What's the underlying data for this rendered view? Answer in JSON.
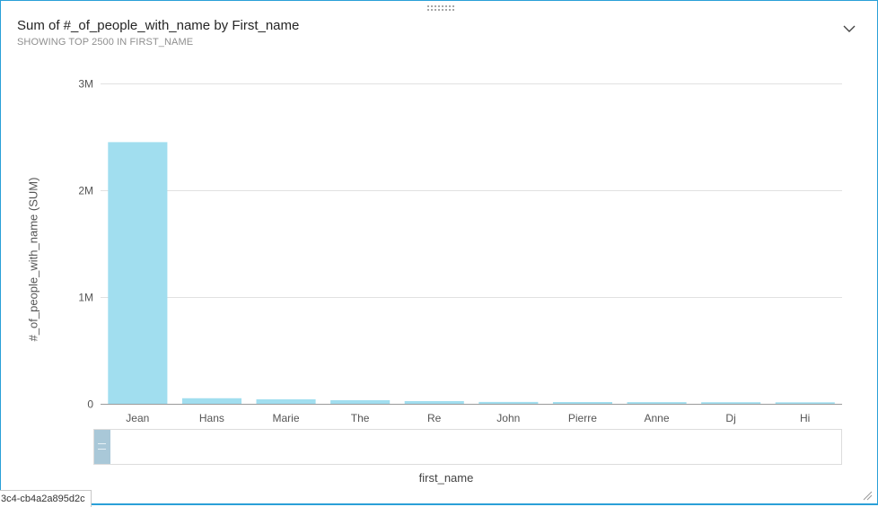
{
  "panel": {
    "title": "Sum of #_of_people_with_name by First_name",
    "subtitle": "SHOWING TOP 2500 IN FIRST_NAME",
    "tooltip_text": "3c4-cb4a2a895d2c"
  },
  "icons": {
    "drag": "drag-handle-icon",
    "chevron": "chevron-down-icon",
    "resize": "resize-grip-icon"
  },
  "colors": {
    "bar": "#a1deef",
    "gridline": "#e1e1e1",
    "axis": "#9a9a9a",
    "border": "#2aa0d8",
    "scroll_thumb": "#a9c8d8"
  },
  "chart_data": {
    "type": "bar",
    "categories": [
      "Jean",
      "Hans",
      "Marie",
      "The",
      "Re",
      "John",
      "Pierre",
      "Anne",
      "Dj",
      "Hi"
    ],
    "values": [
      2450000,
      52000,
      42000,
      34000,
      25000,
      18000,
      17000,
      16000,
      15000,
      14000
    ],
    "xlabel": "first_name",
    "ylabel": "#_of_people_with_name (SUM)",
    "ylim": [
      0,
      3000000
    ],
    "yticks": [
      {
        "value": 0,
        "label": "0"
      },
      {
        "value": 1000000,
        "label": "1M"
      },
      {
        "value": 2000000,
        "label": "2M"
      },
      {
        "value": 3000000,
        "label": "3M"
      }
    ],
    "grid": true,
    "legend": "none"
  }
}
